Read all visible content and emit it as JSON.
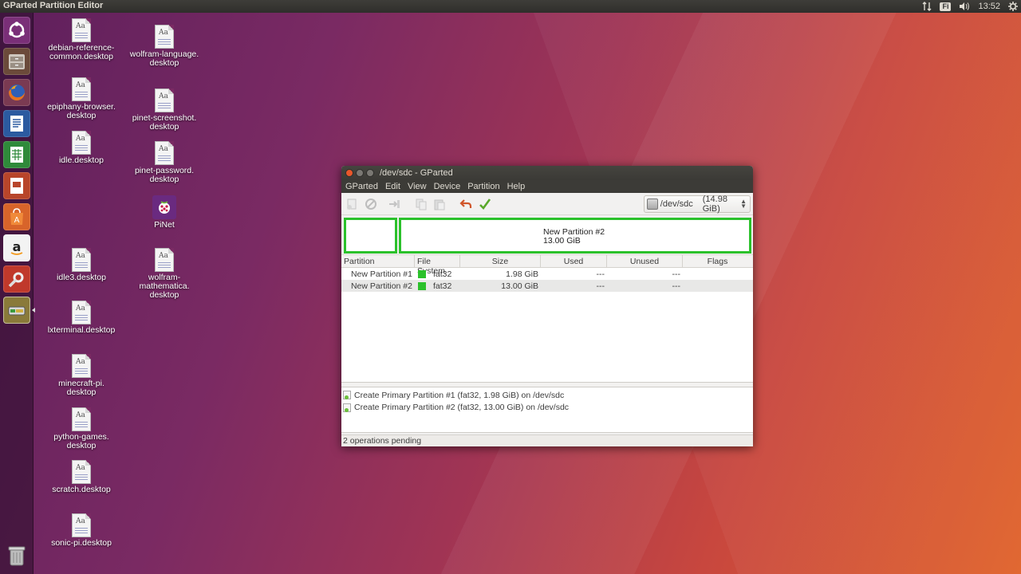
{
  "top_panel": {
    "app_title": "GParted Partition Editor",
    "keyboard_layout": "Fi",
    "clock": "13:52",
    "icons": [
      "network-updown-icon",
      "keyboard-layout-icon",
      "volume-icon",
      "gear-icon"
    ]
  },
  "launcher": {
    "items": [
      {
        "name": "ubuntu-dash",
        "icon": "ubuntu-logo-icon"
      },
      {
        "name": "files",
        "icon": "file-cabinet-icon"
      },
      {
        "name": "firefox",
        "icon": "firefox-icon"
      },
      {
        "name": "writer",
        "icon": "libreoffice-writer-icon"
      },
      {
        "name": "calc",
        "icon": "libreoffice-calc-icon"
      },
      {
        "name": "impress",
        "icon": "libreoffice-impress-icon"
      },
      {
        "name": "software-center",
        "icon": "software-center-icon"
      },
      {
        "name": "amazon",
        "icon": "amazon-icon"
      },
      {
        "name": "system-settings",
        "icon": "settings-tools-icon"
      },
      {
        "name": "gparted",
        "icon": "gparted-icon"
      },
      {
        "name": "trash",
        "icon": "trash-icon"
      }
    ]
  },
  "desktop_icons": [
    {
      "label": "debian-reference-\ncommon.desktop"
    },
    {
      "label": "epiphany-browser.\ndesktop"
    },
    {
      "label": "idle.desktop"
    },
    {
      "label": "idle3.desktop"
    },
    {
      "label": "lxterminal.desktop"
    },
    {
      "label": "minecraft-pi.\ndesktop"
    },
    {
      "label": "python-games.\ndesktop"
    },
    {
      "label": "scratch.desktop"
    },
    {
      "label": "sonic-pi.desktop"
    },
    {
      "label": "wolfram-language.\ndesktop"
    },
    {
      "label": "pinet-screenshot.\ndesktop"
    },
    {
      "label": "pinet-password.\ndesktop"
    },
    {
      "label": "PiNet"
    },
    {
      "label": "wolfram-\nmathematica.\ndesktop"
    }
  ],
  "window": {
    "title": "/dev/sdc - GParted",
    "menu": [
      "GParted",
      "Edit",
      "View",
      "Device",
      "Partition",
      "Help"
    ],
    "device": {
      "name": "/dev/sdc",
      "size": "(14.98 GiB)"
    },
    "diskmap": {
      "partition_name": "New Partition #2",
      "partition_size": "13.00 GiB",
      "color": "#2bc12b"
    },
    "columns": [
      "Partition",
      "File System",
      "Size",
      "Used",
      "Unused",
      "Flags"
    ],
    "rows": [
      {
        "partition": "New Partition #1",
        "fs": "fat32",
        "size": "1.98 GiB",
        "used": "---",
        "unused": "---",
        "flags": ""
      },
      {
        "partition": "New Partition #2",
        "fs": "fat32",
        "size": "13.00 GiB",
        "used": "---",
        "unused": "---",
        "flags": ""
      }
    ],
    "operations": [
      "Create Primary Partition #1 (fat32, 1.98 GiB) on /dev/sdc",
      "Create Primary Partition #2 (fat32, 13.00 GiB) on /dev/sdc"
    ],
    "status": "2 operations pending"
  }
}
